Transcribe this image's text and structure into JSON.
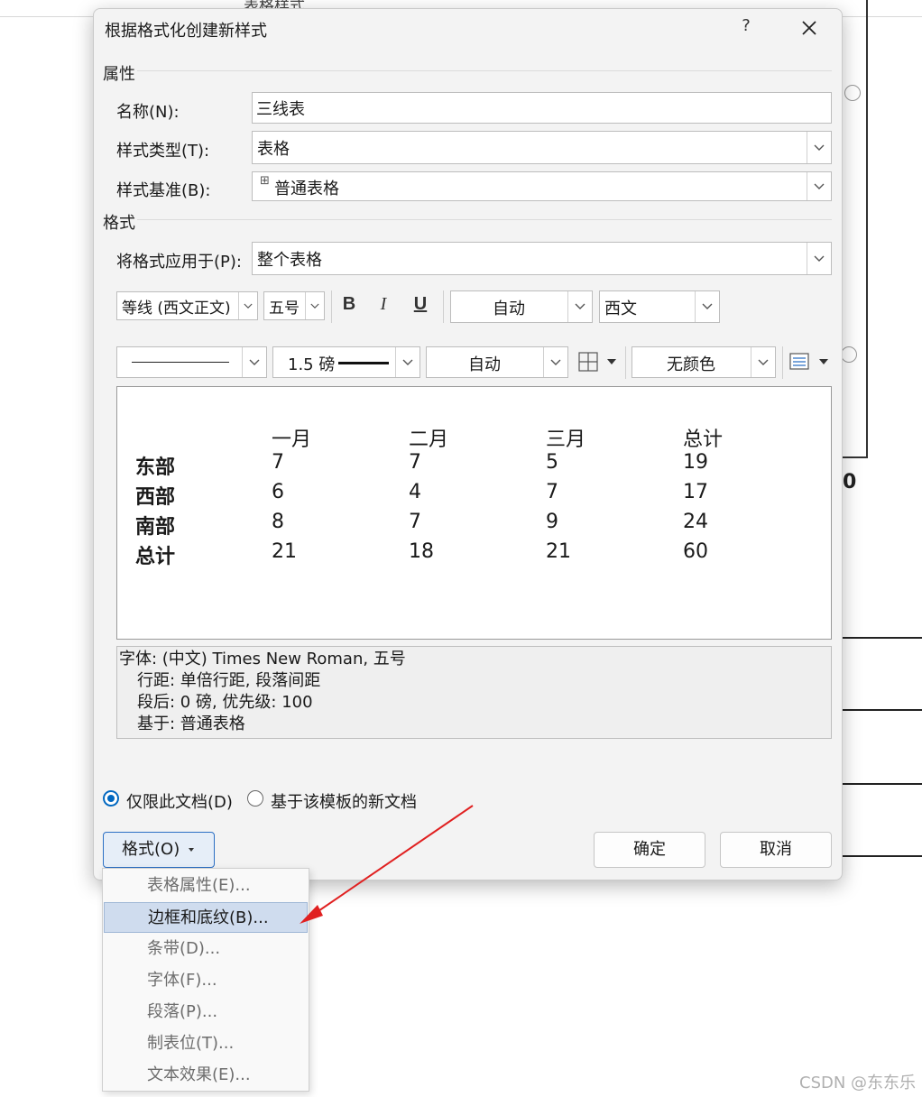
{
  "background": {
    "title_fragment": "表格样式",
    "zero": "0"
  },
  "dialog": {
    "title": "根据格式化创建新样式",
    "help": "?",
    "close": "✕",
    "properties": {
      "section": "属性",
      "name_label": "名称(N):",
      "name_value": "三线表",
      "type_label": "样式类型(T):",
      "type_value": "表格",
      "based_label": "样式基准(B):",
      "based_value": "普通表格",
      "based_icon": "⊞"
    },
    "format": {
      "section": "格式",
      "apply_label": "将格式应用于(P):",
      "apply_value": "整个表格",
      "font": "等线 (西文正文)",
      "size": "五号",
      "bold": "B",
      "italic": "I",
      "underline": "U",
      "color": "自动",
      "script": "西文",
      "border_weight": "1.5 磅",
      "border_color": "自动",
      "shading": "无颜色"
    },
    "preview": {
      "headers": [
        "一月",
        "二月",
        "三月",
        "总计"
      ],
      "rows": [
        {
          "label": "东部",
          "values": [
            "7",
            "7",
            "5",
            "19"
          ]
        },
        {
          "label": "西部",
          "values": [
            "6",
            "4",
            "7",
            "17"
          ]
        },
        {
          "label": "南部",
          "values": [
            "8",
            "7",
            "9",
            "24"
          ]
        },
        {
          "label": "总计",
          "values": [
            "21",
            "18",
            "21",
            "60"
          ]
        }
      ]
    },
    "description": [
      "字体: (中文) Times New Roman, 五号",
      "行距: 单倍行距, 段落间距",
      "段后: 0 磅, 优先级: 100",
      "基于: 普通表格"
    ],
    "scope": {
      "this_doc": "仅限此文档(D)",
      "template": "基于该模板的新文档",
      "selected": "this_doc"
    },
    "buttons": {
      "format": "格式(O)",
      "ok": "确定",
      "cancel": "取消"
    }
  },
  "menu": {
    "items": [
      {
        "label": "表格属性(E)...",
        "highlighted": false
      },
      {
        "label": "边框和底纹(B)...",
        "highlighted": true
      },
      {
        "label": "条带(D)...",
        "highlighted": false
      },
      {
        "label": "字体(F)...",
        "highlighted": false
      },
      {
        "label": "段落(P)...",
        "highlighted": false
      },
      {
        "label": "制表位(T)...",
        "highlighted": false
      },
      {
        "label": "文本效果(E)...",
        "highlighted": false
      }
    ]
  },
  "watermark": "CSDN @东东乐",
  "colors": {
    "accent": "#0067c0",
    "arrow": "#e02020",
    "menu_highlight": "#cfdcee"
  }
}
